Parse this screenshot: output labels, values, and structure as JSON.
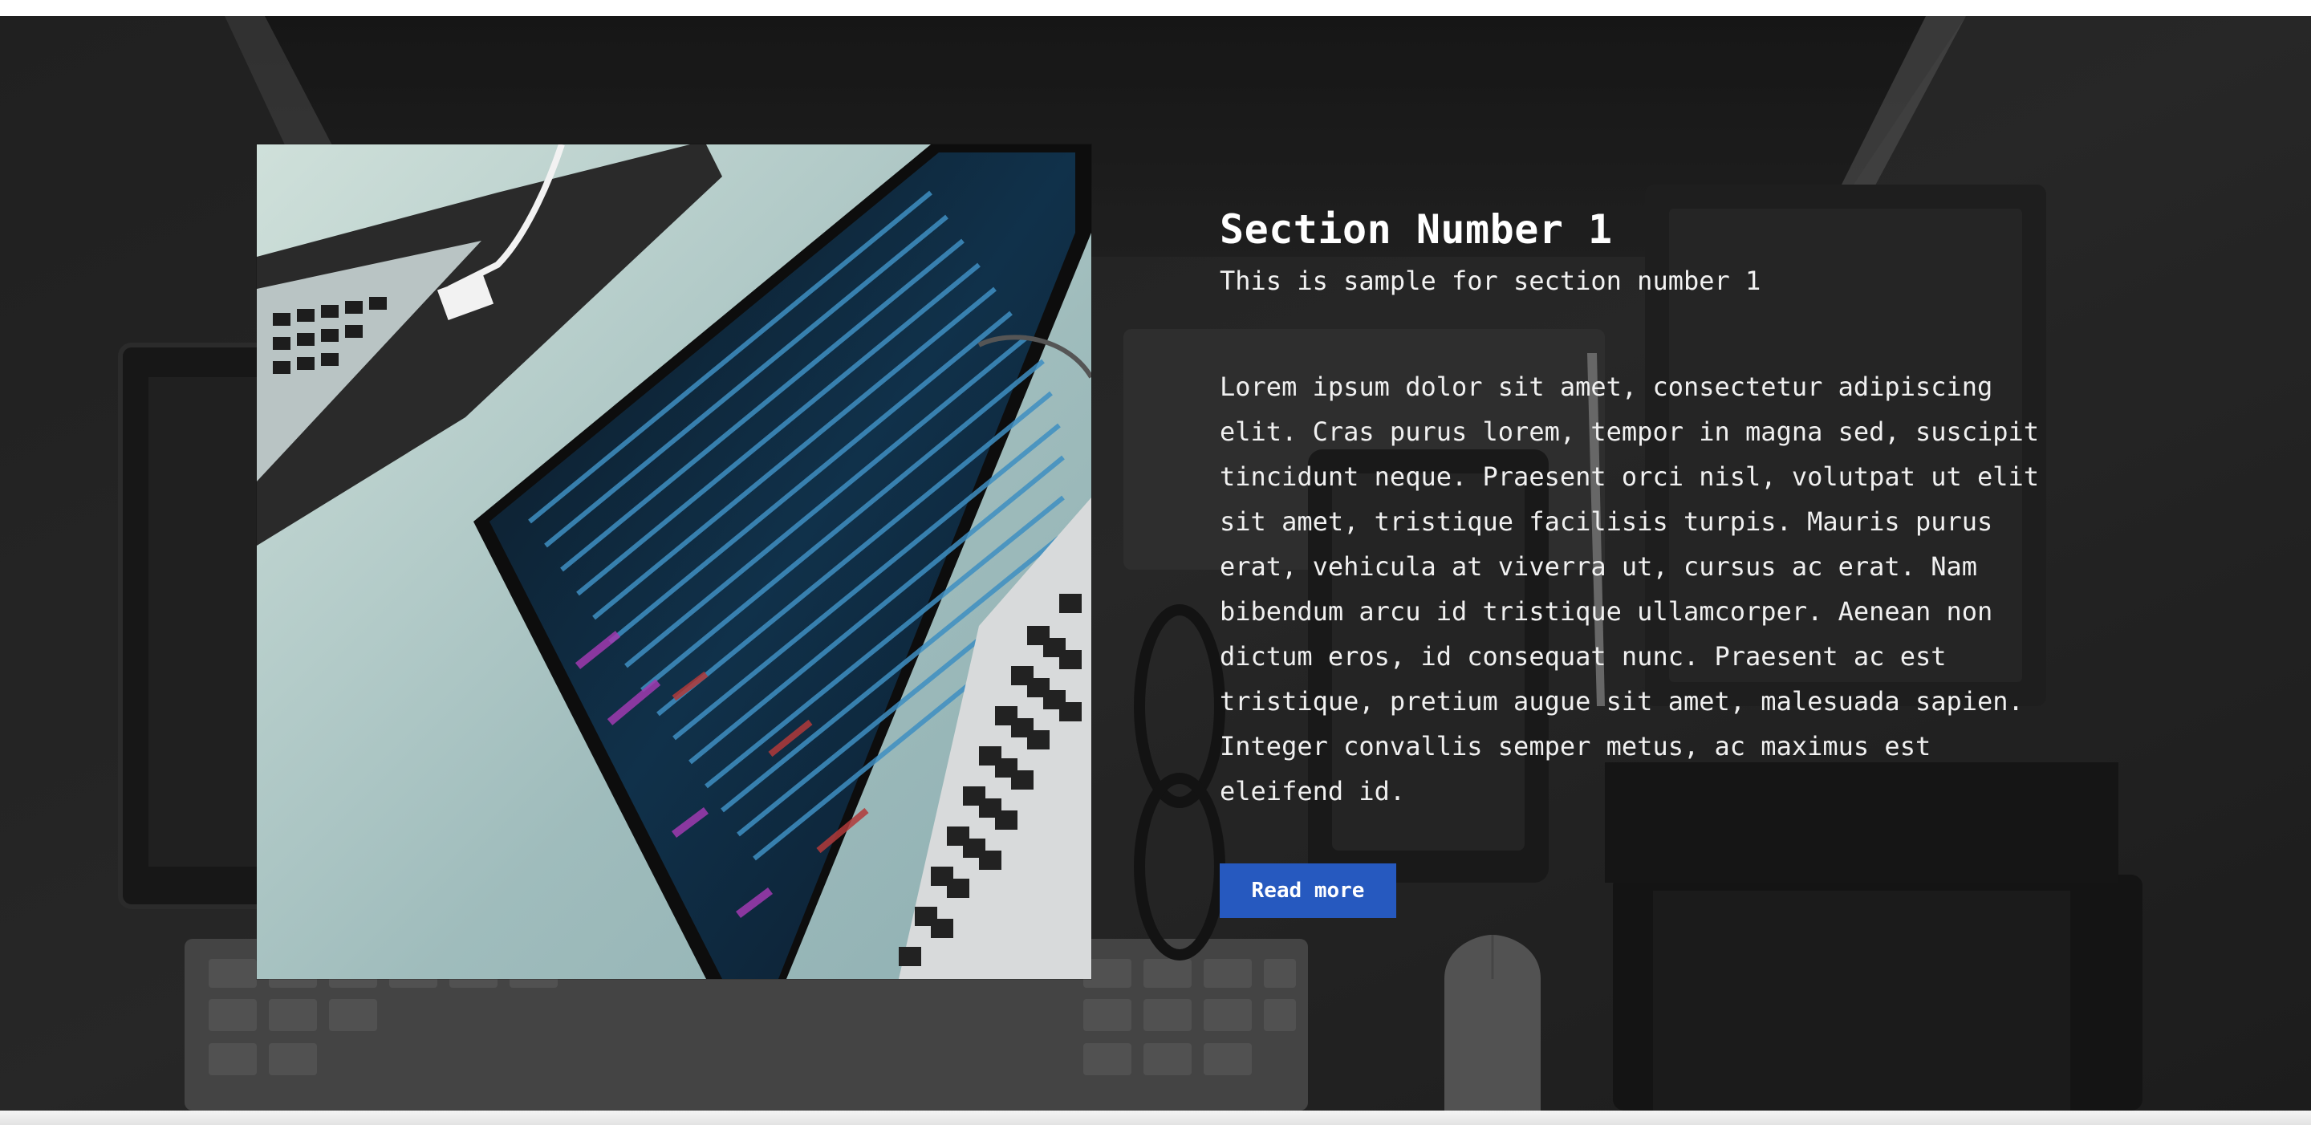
{
  "section": {
    "title": "Section Number 1",
    "subtitle": "This is sample for section number 1",
    "body": "Lorem ipsum dolor sit amet, consectetur adipiscing elit. Cras purus lorem, tempor in magna sed, suscipit tincidunt neque. Praesent orci nisl, volutpat ut elit sit amet, tristique facilisis turpis. Mauris purus erat, vehicula at viverra ut, cursus ac erat. Nam bibendum arcu id tristique ullamcorper. Aenean non dictum eros, id consequat nunc. Praesent ac est tristique, pretium augue sit amet, malesuada sapien. Integer convallis semper metus, ac maximus est eleifend id.",
    "read_more_label": "Read more"
  },
  "colors": {
    "button": "#2659bf",
    "text": "#ffffff",
    "background": "#2a2a2a"
  }
}
